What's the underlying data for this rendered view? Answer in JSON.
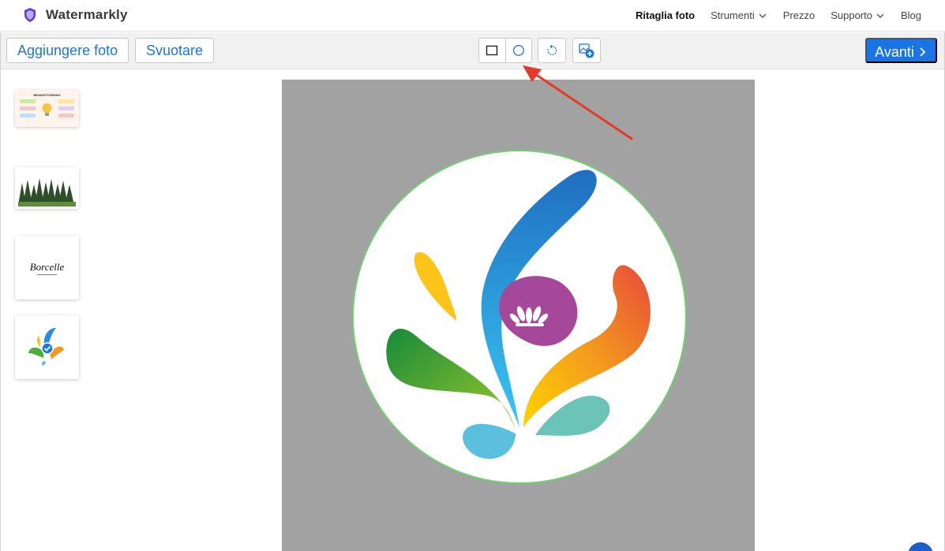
{
  "app": {
    "name": "Watermarkly",
    "logo_color": "#5b3fd1"
  },
  "nav": {
    "items": [
      {
        "label": "Ritaglia foto",
        "active": true,
        "dropdown": false
      },
      {
        "label": "Strumenti",
        "active": false,
        "dropdown": true
      },
      {
        "label": "Prezzo",
        "active": false,
        "dropdown": false
      },
      {
        "label": "Supporto",
        "active": false,
        "dropdown": true
      },
      {
        "label": "Blog",
        "active": false,
        "dropdown": false
      }
    ]
  },
  "toolbar": {
    "add_photos_label": "Aggiungere foto",
    "clear_label": "Svuotare",
    "next_label": "Avanti",
    "tools": [
      "rectangle-crop-icon",
      "circle-crop-icon",
      "rotate-icon",
      "add-image-icon"
    ]
  },
  "thumbnails": [
    {
      "name": "infographic-thumbnail",
      "title": "BRAINSTORMING"
    },
    {
      "name": "forest-thumbnail"
    },
    {
      "name": "borcelle-logo-thumbnail",
      "logo_text": "Borcelle"
    },
    {
      "name": "splash-logo-thumbnail"
    }
  ],
  "colors": {
    "accent": "#1b74e4",
    "canvas_bg": "#a2a2a2",
    "crop_border": "#6fd06f",
    "arrow": "#e53a2a"
  }
}
